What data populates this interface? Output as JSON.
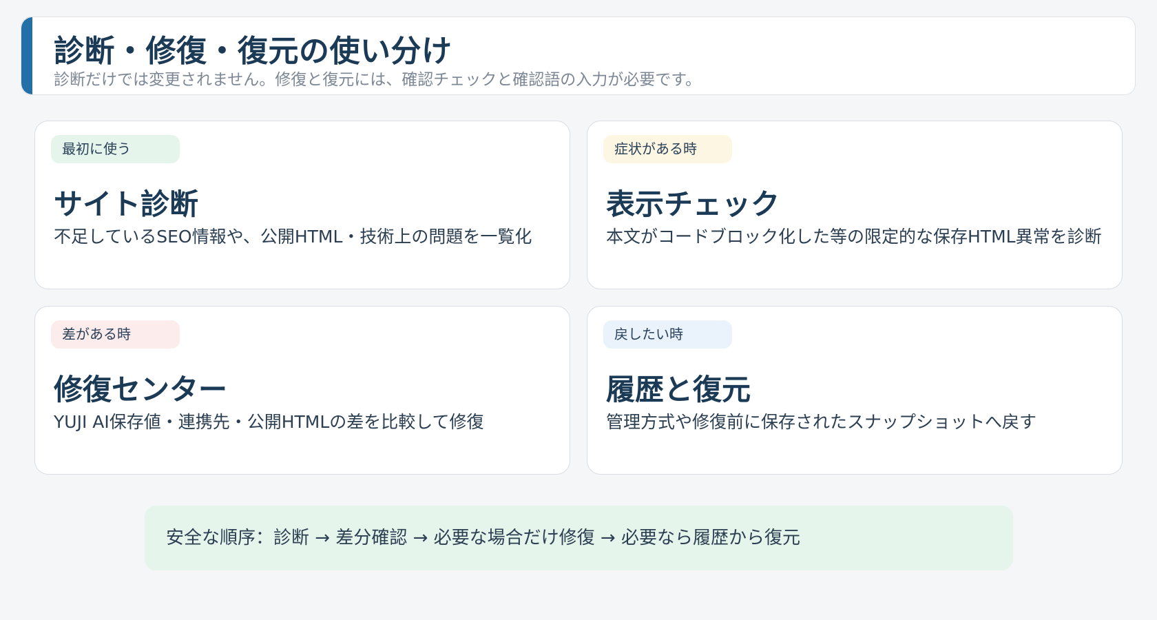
{
  "header": {
    "title": "診断・修復・復元の使い分け",
    "subtitle": "診断だけでは変更されません。修復と復元には、確認チェックと確認語の入力が必要です。",
    "accent_color": "#2370a8"
  },
  "cards": [
    {
      "tag": "最初に使う",
      "tag_color": "#e6f5ec",
      "title": "サイト診断",
      "description": "不足しているSEO情報や、公開HTML・技術上の問題を一覧化"
    },
    {
      "tag": "症状がある時",
      "tag_color": "#fdf6e3",
      "title": "表示チェック",
      "description": "本文がコードブロック化した等の限定的な保存HTML異常を診断"
    },
    {
      "tag": "差がある時",
      "tag_color": "#fdecec",
      "title": "修復センター",
      "description": "YUJI AI保存値・連携先・公開HTMLの差を比較して修復"
    },
    {
      "tag": "戻したい時",
      "tag_color": "#eaf3fb",
      "title": "履歴と復元",
      "description": "管理方式や修復前に保存されたスナップショットへ戻す"
    }
  ],
  "footer": {
    "note": "安全な順序：診断 → 差分確認 → 必要な場合だけ修復 → 必要なら履歴から復元",
    "background_color": "#e6f5ec"
  }
}
